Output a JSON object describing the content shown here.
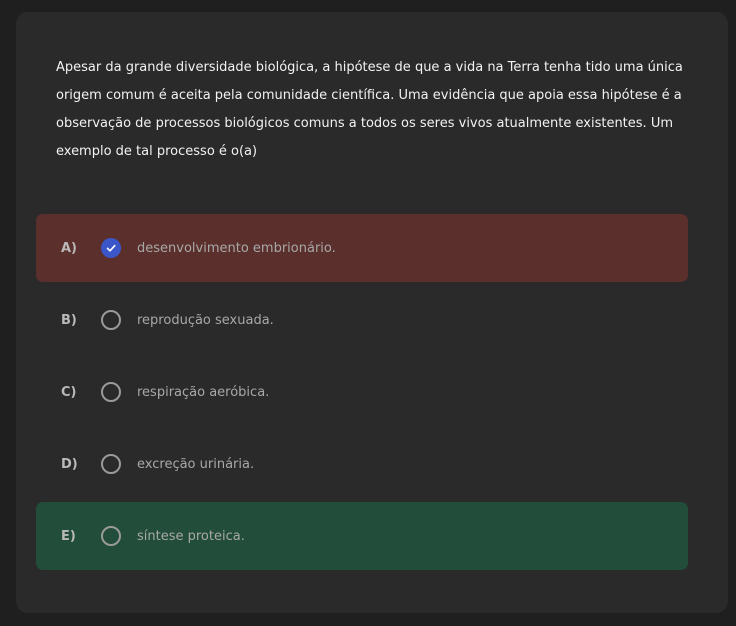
{
  "question": {
    "text": "Apesar da grande diversidade biológica, a hipótese de que a vida na Terra tenha tido uma única origem comum é aceita pela comunidade científica. Uma evidência que apoia essa hipótese é a observação de processos biológicos comuns a todos os seres vivos atualmente existentes. Um exemplo de tal processo é o(a)"
  },
  "options": [
    {
      "letter": "A)",
      "text": "desenvolvimento embrionário.",
      "state": "selected-wrong"
    },
    {
      "letter": "B)",
      "text": "reprodução sexuada.",
      "state": "none"
    },
    {
      "letter": "C)",
      "text": "respiração aeróbica.",
      "state": "none"
    },
    {
      "letter": "D)",
      "text": "excreção urinária.",
      "state": "none"
    },
    {
      "letter": "E)",
      "text": "síntese proteica.",
      "state": "correct"
    }
  ],
  "colors": {
    "background": "#1f1f1f",
    "card": "#2a2a2a",
    "wrong_highlight": "#5b302c",
    "correct_highlight": "#224d3b",
    "selected_radio": "#3a56c9"
  },
  "icons": {
    "selected": "check-icon",
    "unselected": "radio-empty-icon"
  }
}
